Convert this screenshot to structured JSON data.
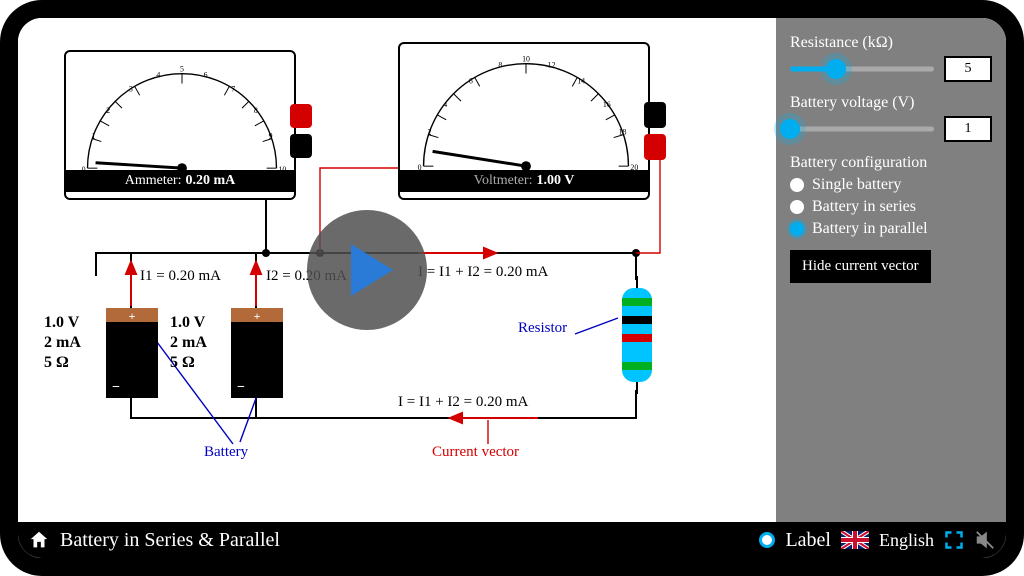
{
  "footer": {
    "title": "Battery in Series & Parallel",
    "label_toggle": "Label",
    "language": "English"
  },
  "panel": {
    "resistance_label": "Resistance (kΩ)",
    "resistance_value": "5",
    "resistance_pct": 32,
    "voltage_label": "Battery voltage (V)",
    "voltage_value": "1",
    "voltage_pct": 0,
    "config_label": "Battery configuration",
    "config_options": {
      "single": "Single battery",
      "series": "Battery in series",
      "parallel": "Battery in parallel"
    },
    "config_selected": "parallel",
    "hide_btn": "Hide current vector"
  },
  "meters": {
    "ammeter_label": "Ammeter:",
    "ammeter_value": "0.20 mA",
    "ammeter_scale": [
      "0",
      "1",
      "2",
      "3",
      "4",
      "5",
      "6",
      "7",
      "8",
      "9",
      "10"
    ],
    "ammeter_needle_frac": 0.02,
    "voltmeter_label": "Voltmeter:",
    "voltmeter_value": "1.00 V",
    "voltmeter_scale": [
      "0",
      "2",
      "4",
      "6",
      "8",
      "10",
      "12",
      "14",
      "16",
      "18",
      "20"
    ],
    "voltmeter_needle_frac": 0.05
  },
  "circuit": {
    "i1_label": "I1 = 0.20 mA",
    "i2_label": "I2 = 0.20 mA",
    "i_sum_top": "I = I1 + I2 = 0.20 mA",
    "i_sum_bottom": "I = I1 + I2 = 0.20 mA",
    "battery_label": "Battery",
    "resistor_label": "Resistor",
    "vector_label": "Current vector",
    "battery_spec": {
      "voltage": "1.0 V",
      "current": "2 mA",
      "resistance": "5 Ω"
    }
  }
}
